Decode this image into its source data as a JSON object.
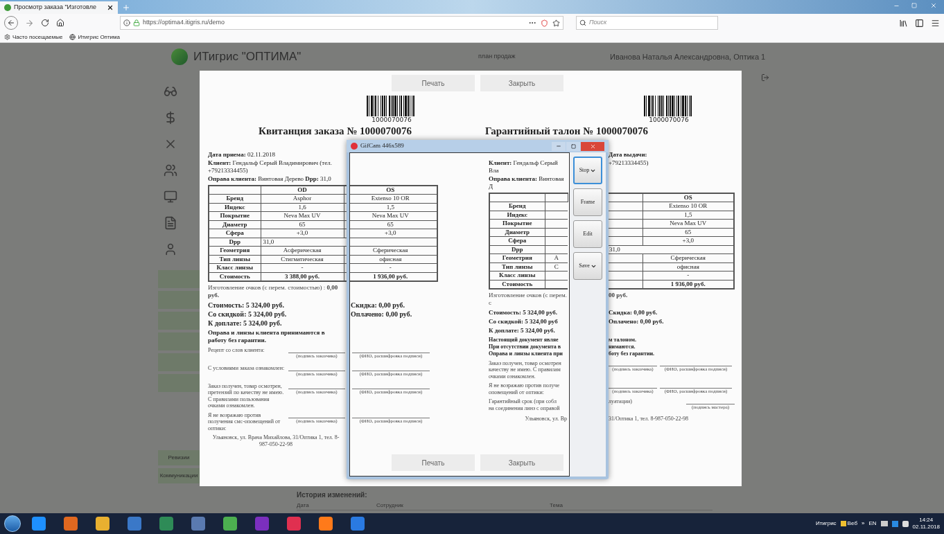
{
  "browser": {
    "tabs": [
      {
        "label": "Просмотр заказа \"Изготовле",
        "selected": true
      }
    ],
    "url": "https://optima4.itigris.ru/demo",
    "search": {
      "placeholder": "Поиск"
    },
    "bookmarks": [
      "Часто посещаемые",
      "Итигрис Оптима"
    ]
  },
  "app": {
    "logo_text": "ИТигрис \"ОПТИМА\"",
    "nav_link": "план продаж",
    "user": "Иванова Наталья Александровна, Оптика 1",
    "sidebar_buttons": [
      "Ревизии",
      "Коммуникации"
    ],
    "history": {
      "title": "История изменений:",
      "columns": [
        "Дата",
        "Сотрудник",
        "Тема"
      ]
    }
  },
  "modal": {
    "buttons": [
      "Печать",
      "Закрыть"
    ],
    "bottom_buttons": [
      "Печать",
      "Закрыть"
    ],
    "receipt": {
      "barcode_number": "1000070076",
      "title": "Квитанция заказа № 1000070076",
      "header_lines": [
        "**Дата приема:** 02.11.2018",
        "**Клиент:** Гендальф Серый Владимирович (тел. +79213334455)",
        "**Оправа клиента:** Винтовая Дерево **Dpp:** 31,0"
      ],
      "table": [
        {
          "kind": "header",
          "od": "OD",
          "os": "OS"
        },
        {
          "kind": "row",
          "label": "Бренд",
          "od": "Asphor",
          "os": "Extenso 10 OR"
        },
        {
          "kind": "row",
          "label": "Индекс",
          "od": "1,6",
          "os": "1,5"
        },
        {
          "kind": "row",
          "label": "Покрытие",
          "od": "Neva Max UV",
          "os": "Neva Max UV"
        },
        {
          "kind": "row",
          "label": "Диаметр",
          "od": "65",
          "os": "65"
        },
        {
          "kind": "row",
          "label": "Сфера",
          "od": "+3,0",
          "os": "+3,0"
        },
        {
          "kind": "span",
          "label": "Dpp",
          "value": "31,0"
        },
        {
          "kind": "row",
          "label": "Геометрия",
          "od": "Асферическая",
          "os": "Сферическая"
        },
        {
          "kind": "row",
          "label": "Тип линзы",
          "od": "Стигматическая",
          "os": "офисная"
        },
        {
          "kind": "row",
          "label": "Класс линзы",
          "od": "-",
          "os": "-"
        },
        {
          "kind": "total",
          "label": "Стоимость",
          "od": "3 388,00 руб.",
          "os": "1 936,00 руб."
        }
      ],
      "manufacturing": "Изготовление очков (с перем. стоимостью) : **0,00 руб.**",
      "totals": [
        {
          "left": "Стоимость: 5 324,00 руб.",
          "right": "Скидка: 0,00 руб."
        },
        {
          "left": "Со скидкой: 5 324,00 руб.",
          "right": "Оплачено: 0,00 руб."
        },
        {
          "left": "К доплате: 5 324,00 руб."
        }
      ],
      "notice": "Оправа и линзы клиента принимаются в работу без гарантии.",
      "signature_rows": [
        {
          "text": "Рецепт со слов клиента:",
          "captions": [
            "(подпись заказчика)",
            "(ФИО, расшифровка подписи)"
          ]
        },
        {
          "text": "С условиями заказа ознакомлен:",
          "captions": [
            "(подпись заказчика)",
            "(ФИО, расшифровка подписи)"
          ]
        },
        {
          "text": "Заказ получен, товар осмотрен, претензий по качеству не имею. С правилами пользования очками ознакомлен.",
          "captions": [
            "(подпись заказчика)",
            "(ФИО, расшифровка подписи)"
          ]
        },
        {
          "text": "Я не возражаю против получения смс-оповещений от оптики:",
          "captions": [
            "(подпись заказчика)",
            "(ФИО, расшифровка подписи)"
          ]
        }
      ],
      "footer": "Ульяновск, ул. Врача Михайлова, 31/Оптика 1, тел. 8-987-050-22-98"
    },
    "warranty": {
      "barcode_number": "1000070076",
      "title": "Гарантийный талон № 1000070076",
      "header_lines": [
        {
          "right": "Дата выдачи:"
        },
        {
          "left": "**Клиент:** Гендальф Серый Вла",
          "right": "+79213334455)"
        },
        {
          "left": "**Оправа клиента:** Винтовая Д"
        }
      ],
      "table": [
        {
          "kind": "header",
          "os": "OS"
        },
        {
          "kind": "row",
          "label": "Бренд",
          "os": "Extenso 10 OR"
        },
        {
          "kind": "row",
          "label": "Индекс",
          "os": "1,5"
        },
        {
          "kind": "row",
          "label": "Покрытие",
          "os": "Neva Max UV"
        },
        {
          "kind": "row",
          "label": "Диаметр",
          "os": "65"
        },
        {
          "kind": "row",
          "label": "Сфера",
          "os": "+3,0"
        },
        {
          "kind": "span",
          "label": "Dpp",
          "value": "31,0"
        },
        {
          "kind": "row",
          "label": "Геометрия",
          "od": "А",
          "os": "Сферическая"
        },
        {
          "kind": "row",
          "label": "Тип линзы",
          "od": "С",
          "os": "офисная"
        },
        {
          "kind": "row",
          "label": "Класс линзы",
          "os": "-"
        },
        {
          "kind": "total",
          "label": "Стоимость",
          "os": "1 936,00 руб."
        }
      ],
      "manufacturing": {
        "left": "Изготовление очков (с перем. с",
        "right": "00 руб."
      },
      "totals": [
        {
          "left": "Стоимость: 5 324,00 руб.",
          "right": "Скидка: 0,00 руб."
        },
        {
          "left": "Со скидкой: 5 324,00 руб",
          "right": "Оплачено: 0,00 руб."
        },
        {
          "left": "К доплате: 5 324,00 руб."
        }
      ],
      "notice": [
        {
          "left": "Настоящий документ являе",
          "right": "м талоном."
        },
        {
          "left": "При отсутствии документа в",
          "right": "нимаются."
        },
        {
          "left": "Оправа и линзы клиента при",
          "right": "боту без гарантии."
        }
      ],
      "signature_rows": [
        {
          "text": "Заказ получен, товар осмотрен\nкачеству не имею. С правилам\nочками ознакомлен.",
          "captions": [
            "(подпись заказчика)",
            "(ФИО, расшифровка подписи)"
          ]
        },
        {
          "text": "Я не возражаю против получе\nоповещений от оптики:",
          "captions": [
            "(подпись заказчика)",
            "(ФИО, расшифровка подписи)"
          ]
        },
        {
          "text": "Гарантийный срок (при собл\nна соединения линз с оправой",
          "note": "луатации)",
          "captions": [
            "(подпись мастера)"
          ]
        }
      ],
      "footer": {
        "left": "Ульяновск, ул. Вр",
        "right": "31/Оптика 1, тел. 8-987-050-22-98"
      }
    }
  },
  "gifcam": {
    "title": "GifCam 446x589",
    "buttons": [
      {
        "label": "Stop",
        "dropdown": true,
        "selected": true
      },
      {
        "label": "Frame",
        "dropdown": false,
        "selected": false
      },
      {
        "label": "Edit",
        "dropdown": false,
        "selected": false
      },
      {
        "label": "Save",
        "dropdown": true,
        "selected": false
      }
    ]
  },
  "taskbar": {
    "tray_label": "Итигрис",
    "tray_item": "Beб",
    "overflow": "»",
    "language": "EN",
    "time": "14:24",
    "date": "02.11.2018"
  }
}
